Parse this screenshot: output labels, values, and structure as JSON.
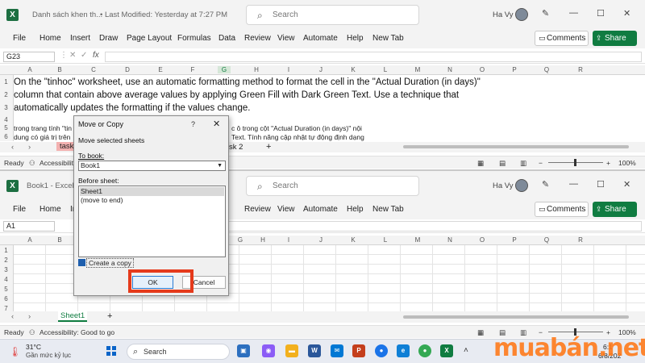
{
  "top_window": {
    "title": "Danh sách khen th...",
    "modified": "• Last Modified: Yesterday at 7:27 PM",
    "search_placeholder": "Search",
    "user": "Ha Vy",
    "menu": [
      "File",
      "Home",
      "Insert",
      "Draw",
      "Page Layout",
      "Formulas",
      "Data",
      "Review",
      "View",
      "Automate",
      "Help",
      "New Tab"
    ],
    "comments_label": "Comments",
    "share_label": "Share",
    "name_box": "G23",
    "fx": "fx",
    "columns": [
      "A",
      "B",
      "C",
      "D",
      "E",
      "F",
      "G",
      "H",
      "I",
      "J",
      "K",
      "L",
      "M",
      "N",
      "O",
      "P",
      "Q",
      "R"
    ],
    "rows": [
      "1",
      "2",
      "3",
      "4",
      "5",
      "6"
    ],
    "task_text_lines": [
      "On the \"tinhoc\" worksheet, use an automatic formatting method to format the cell in the \"Actual Duration (in days)\"",
      "column that contain above average  values by applying Green Fill with Dark Green Text. Use a technique that",
      "automatically updates the formatting if the values change."
    ],
    "vn_text_row5_left": "trong trang tính \"tin",
    "vn_text_row6_left": "dung có giá trị trên",
    "vn_text_row5_right": "c ô trong cột \"Actual Duration (in days)\" nội",
    "vn_text_row6_right": "Text. Tính năng cập nhật tự động định dạng",
    "sheet_tab_task": "task",
    "sheet_tab_2": "sk 2",
    "status_ready": "Ready",
    "status_accessibility": "Accessibility:",
    "zoom": "100%"
  },
  "bottom_window": {
    "title": "Book1 - Excel",
    "search_placeholder": "Search",
    "user": "Ha Vy",
    "menu": [
      "File",
      "Home",
      "In",
      "Review",
      "View",
      "Automate",
      "Help",
      "New Tab"
    ],
    "comments_label": "Comments",
    "share_label": "Share",
    "name_box": "A1",
    "columns": [
      "A",
      "B",
      "C",
      "D",
      "E",
      "F",
      "G",
      "H",
      "I",
      "J",
      "K",
      "L",
      "M",
      "N",
      "O",
      "P",
      "Q",
      "R"
    ],
    "rows": [
      "1",
      "2",
      "3",
      "4",
      "5",
      "6",
      "7"
    ],
    "sheet_tab": "Sheet1",
    "status_ready": "Ready",
    "status_accessibility": "Accessibility: Good to go",
    "zoom": "100%"
  },
  "dialog": {
    "title": "Move or Copy",
    "help": "?",
    "close": "✕",
    "subtitle": "Move selected sheets",
    "to_book_label": "To book:",
    "to_book_value": "Book1",
    "before_sheet_label": "Before sheet:",
    "before_sheet_items": [
      "Sheet1",
      "(move to end)"
    ],
    "create_copy_label": "Create a copy",
    "create_copy_checked": true,
    "ok_label": "OK",
    "cancel_label": "Cancel"
  },
  "taskbar": {
    "temp": "31°C",
    "weather": "Gần mức kỷ lục",
    "search_label": "Search",
    "time": "6:1",
    "date": "6/8/202"
  },
  "watermark": "muabán.net",
  "colors": {
    "excel_green": "#107c41",
    "highlight_red": "#e53a1b",
    "watermark_orange": "#ff7b1c"
  }
}
